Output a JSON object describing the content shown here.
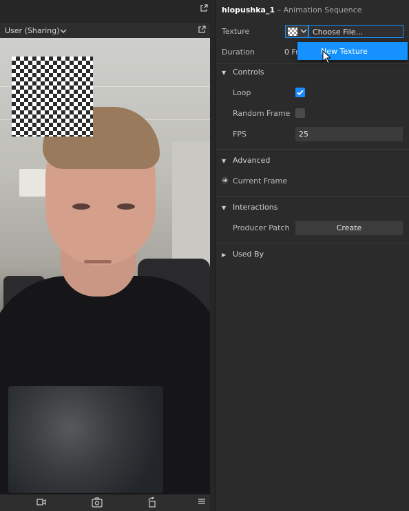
{
  "viewport": {
    "source_label": "User (Sharing)",
    "icons": {
      "external": "external-link-icon",
      "chevron": "chevron-down-icon",
      "video": "video-camera-icon",
      "camera_switch": "camera-switch-icon",
      "rotate": "rotate-icon",
      "menu": "hamburger-menu-icon"
    }
  },
  "inspector": {
    "object_name": "hlopushka_1",
    "object_type": " – Animation Sequence",
    "texture": {
      "label": "Texture",
      "value": "Choose File..."
    },
    "duration": {
      "label": "Duration",
      "value": "0 Fr"
    },
    "dropdown_menu": {
      "items": [
        "New Texture"
      ]
    },
    "controls": {
      "title": "Controls",
      "loop": {
        "label": "Loop",
        "checked": true
      },
      "random_frame": {
        "label": "Random Frame",
        "checked": false
      },
      "fps": {
        "label": "FPS",
        "value": "25"
      }
    },
    "advanced": {
      "title": "Advanced",
      "current_frame_label": "Current Frame"
    },
    "interactions": {
      "title": "Interactions",
      "producer_patch_label": "Producer Patch",
      "create_label": "Create"
    },
    "used_by": {
      "title": "Used By"
    }
  },
  "colors": {
    "accent": "#1592ff",
    "panel_bg": "#2b2b2b",
    "text": "#cfcfcf"
  }
}
